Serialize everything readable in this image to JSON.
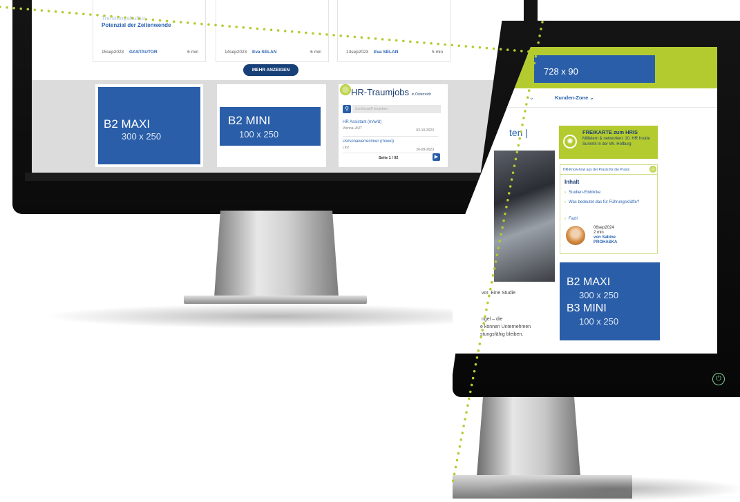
{
  "left_screen": {
    "cards": [
      {
        "title_line1": "Trennungskultur",
        "title_line2": "Potenzial der Zeitenwende",
        "date": "15sep2023",
        "author": "GASTAUTOR",
        "read_time": "6 min"
      },
      {
        "title_line1": "",
        "title_line2": "",
        "date": "14sep2023",
        "author": "Eva SELAN",
        "read_time": "6 min"
      },
      {
        "title_line1": "",
        "title_line2": "",
        "date": "13sep2023",
        "author": "Eva SELAN",
        "read_time": "5 min"
      }
    ],
    "more_button": "MEHR ANZEIGEN",
    "ad_maxi": {
      "name": "B2 MAXI",
      "size": "300 x 250"
    },
    "ad_mini": {
      "name": "B2 MINI",
      "size": "100 x 250"
    },
    "hr_widget": {
      "logo": "HR-Traumjobs",
      "logo_suffix": "in Österreich",
      "search_placeholder": "Suchbegriff eingeben",
      "jobs": [
        {
          "title": "HR Assistant (m/w/d)",
          "location": "Vienna, AUT",
          "date": "03-10-2023"
        },
        {
          "title": "Personalverrechner (m/w/d)",
          "location": "Linz",
          "date": "20-09-2023"
        }
      ],
      "pagination": "Seite 1 / 92"
    }
  },
  "right_screen": {
    "leaderboard": "728 x 90",
    "nav": {
      "chevron": "⌄",
      "kunden_zone": "Kunden-Zone ⌄"
    },
    "headline_fragment": "ten |",
    "body_fragments": [
      "vor. Eine Studie",
      "ngel – die",
      "e können Unternehmen",
      "stungsfähig bleiben."
    ],
    "promo": {
      "title": "FREIKARTE zum HRIS",
      "text": "Mitfeiern & networken: 10. HR Inside Summit in der Wr. Hofburg"
    },
    "toc": {
      "bar_text": "HR-Know-how aus der Praxis für die Praxis",
      "heading": "Inhalt",
      "items": [
        "Studien-Einblicke",
        "Was bedeutet das für Führungskräfte?",
        "Fazit"
      ],
      "date": "06sep2024",
      "read_time": "2 min",
      "author_prefix": "von Sabine",
      "author_name": "PROHASKA"
    },
    "ad_b2": {
      "name": "B2 MAXI",
      "size": "300 x 250"
    },
    "ad_b3": {
      "name": "B3 MINI",
      "size": "100 x 250"
    }
  },
  "colors": {
    "accent_green": "#b4cb2f",
    "brand_blue": "#2a5ea8",
    "navy": "#173f78"
  },
  "icons": [
    "search-icon",
    "next-page-icon",
    "power-icon",
    "promo-badge-icon",
    "chevron-right-icon"
  ]
}
